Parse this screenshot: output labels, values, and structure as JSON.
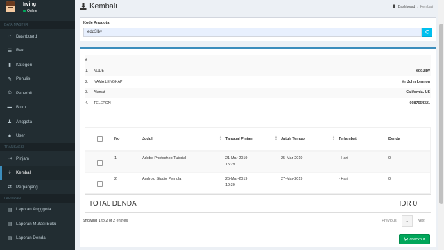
{
  "user": {
    "name": "Irving",
    "status": "Online"
  },
  "sidebar": {
    "sections": [
      {
        "header": "DATA MASTER",
        "items": [
          {
            "label": "Dashboard",
            "icon": "dashboard-icon"
          },
          {
            "label": "Rak",
            "icon": "list-icon"
          },
          {
            "label": "Kategori",
            "icon": "bookmark-icon"
          },
          {
            "label": "Penulis",
            "icon": "pencil-icon"
          },
          {
            "label": "Penerbit",
            "icon": "copyright-icon"
          },
          {
            "label": "Buku",
            "icon": "book-icon"
          },
          {
            "label": "Anggota",
            "icon": "users-icon"
          },
          {
            "label": "User",
            "icon": "lock-icon"
          }
        ]
      },
      {
        "header": "TRANSAKSI",
        "items": [
          {
            "label": "Pinjam",
            "icon": "exit-icon"
          },
          {
            "label": "Kembali",
            "icon": "download-icon",
            "active": true
          },
          {
            "label": "Perpanjang",
            "icon": "swap-icon"
          }
        ]
      },
      {
        "header": "LAPORAN",
        "items": [
          {
            "label": "Laporan Angggota",
            "icon": "report-icon"
          },
          {
            "label": "Laporan Mutasi Buku",
            "icon": "report-icon"
          },
          {
            "label": "Laporan Denda",
            "icon": "report-icon"
          }
        ]
      }
    ]
  },
  "header": {
    "title": "Kembali",
    "breadcrumb": [
      "Dashboard",
      "Kembali"
    ],
    "separator": "›"
  },
  "search": {
    "label": "Kode Anggota",
    "value": "edq3lbv",
    "button_icon": "refresh-icon"
  },
  "member": {
    "header": "#",
    "rows": [
      {
        "num": "1.",
        "label": "KODE",
        "value": "edq3lbv"
      },
      {
        "num": "2.",
        "label": "NAMA LENGKAP",
        "value": "Mr John Lennon"
      },
      {
        "num": "3.",
        "label": "Alamat",
        "value": "California. US"
      },
      {
        "num": "4.",
        "label": "TELEPON",
        "value": "0987654321"
      }
    ]
  },
  "loans": {
    "columns": [
      "No",
      "Judul",
      "Tanggal Pinjam",
      "Jatuh Tempo",
      "Terlambat",
      "Denda"
    ],
    "rows": [
      {
        "no": "1",
        "judul": "Adobe Photoshop Tutorial",
        "tgl": "21-Mar-2019",
        "jam": "15:29",
        "jatuh": "25-Mar-2019",
        "terlambat": "- Hari",
        "denda": "0"
      },
      {
        "no": "2",
        "judul": "Android Studio Pemula",
        "tgl": "25-Mar-2019",
        "jam": "19:30",
        "jatuh": "27-Mar-2019",
        "terlambat": "- Hari",
        "denda": "0"
      }
    ]
  },
  "total": {
    "label": "TOTAL DENDA",
    "value": "IDR 0"
  },
  "table_info": "Showing 1 to 2 of 2 entries",
  "pagination": {
    "previous": "Previous",
    "current": "1",
    "next": "Next"
  },
  "checkout_label": "checkout",
  "colors": {
    "sidebar": "#222d32",
    "accent": "#3c8dbc",
    "success": "#00a65a",
    "info": "#00c0ef"
  }
}
